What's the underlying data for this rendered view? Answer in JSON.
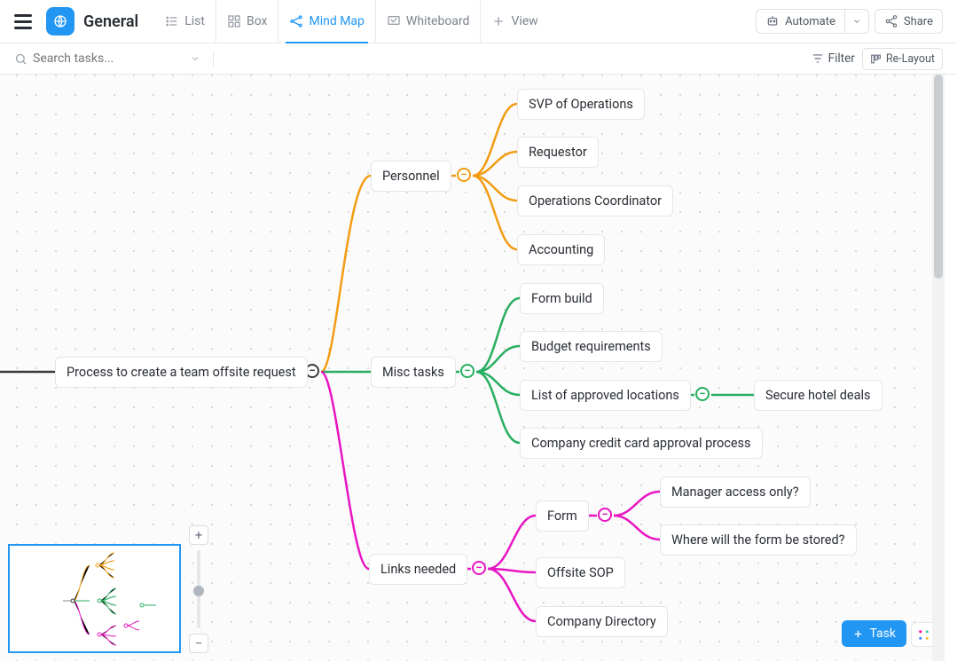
{
  "header": {
    "space_name": "General",
    "tabs": {
      "list": "List",
      "box": "Box",
      "mindmap": "Mind Map",
      "whiteboard": "Whiteboard",
      "addview": "View"
    },
    "automate_label": "Automate",
    "share_label": "Share"
  },
  "filterbar": {
    "search_placeholder": "Search tasks...",
    "filter_label": "Filter",
    "relayout_label": "Re-Layout"
  },
  "colors": {
    "orange": "#f39c12",
    "green": "#27ae60",
    "pink": "#e815c2",
    "root": "#3a3a3a"
  },
  "mindmap": {
    "root": "Process to create a team offsite request",
    "branches": [
      {
        "label": "Personnel",
        "color": "orange",
        "children": [
          {
            "label": "SVP of Operations"
          },
          {
            "label": "Requestor"
          },
          {
            "label": "Operations Coordinator"
          },
          {
            "label": "Accounting"
          }
        ]
      },
      {
        "label": "Misc tasks",
        "color": "green",
        "children": [
          {
            "label": "Form build"
          },
          {
            "label": "Budget requirements"
          },
          {
            "label": "List of approved locations",
            "children": [
              {
                "label": "Secure hotel deals"
              }
            ]
          },
          {
            "label": "Company credit card approval process"
          }
        ]
      },
      {
        "label": "Links needed",
        "color": "pink",
        "children": [
          {
            "label": "Form",
            "children": [
              {
                "label": "Manager access only?"
              },
              {
                "label": "Where will the form be stored?"
              }
            ]
          },
          {
            "label": "Offsite SOP"
          },
          {
            "label": "Company Directory"
          }
        ]
      }
    ]
  },
  "floating": {
    "task_btn": "Task"
  }
}
